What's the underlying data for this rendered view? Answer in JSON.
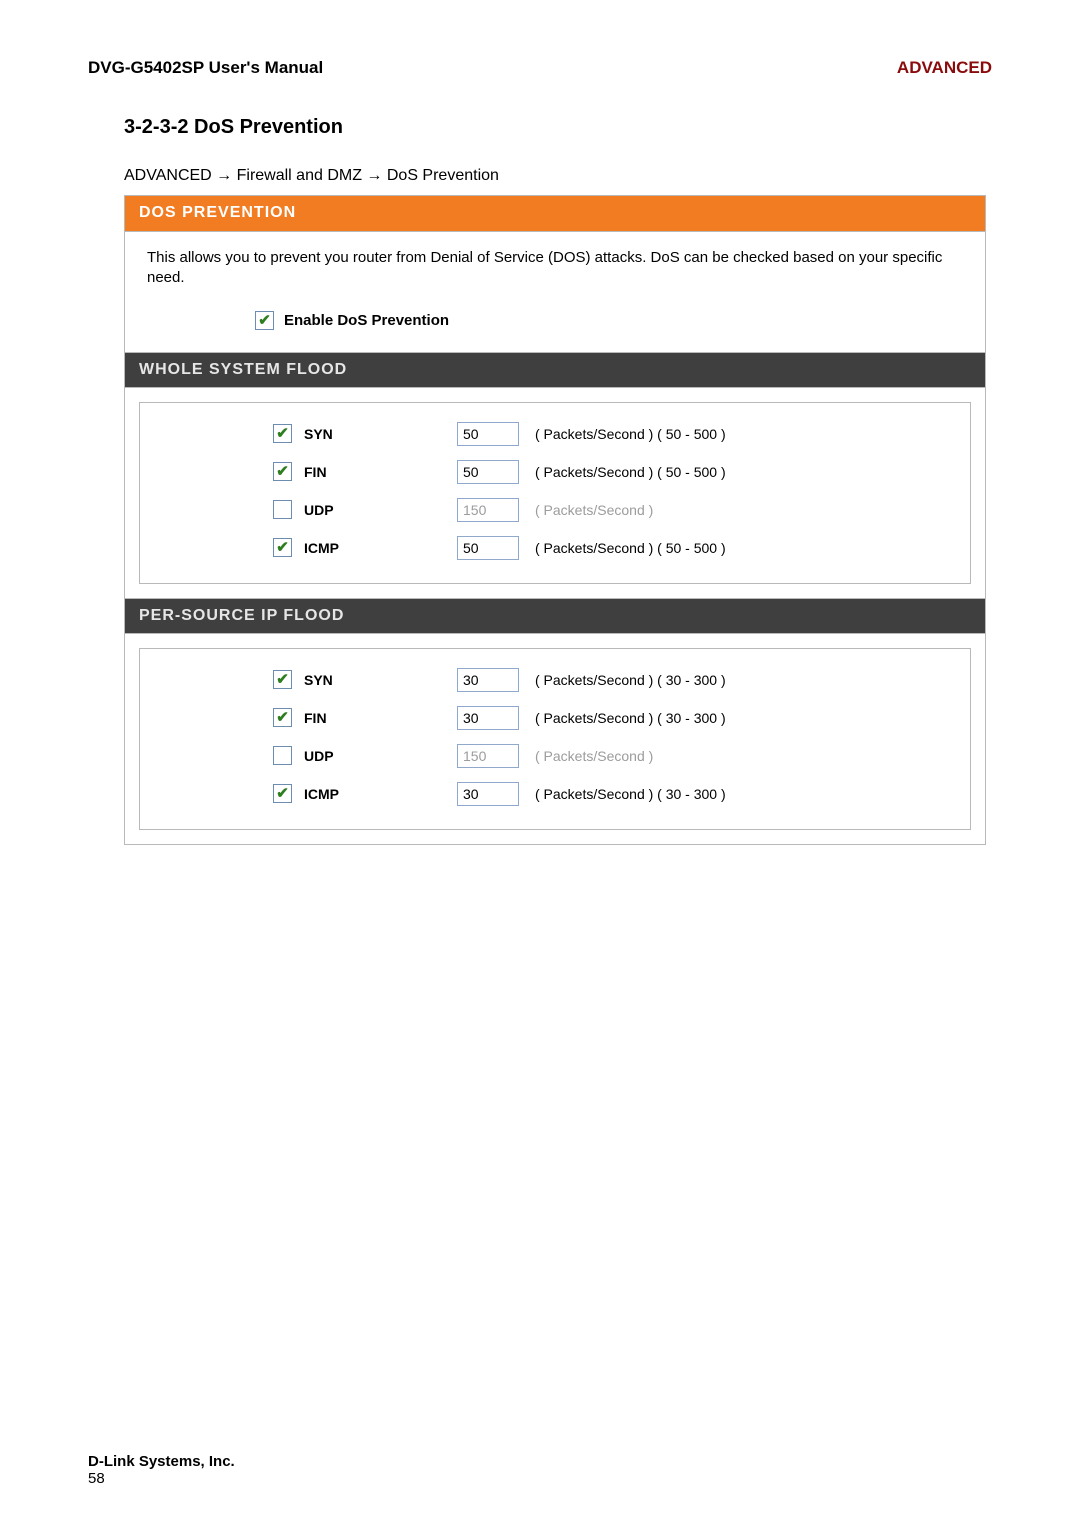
{
  "header": {
    "manual_title": "DVG-G5402SP User's Manual",
    "section_tag": "ADVANCED"
  },
  "section": {
    "heading": "3-2-3-2 DoS Prevention",
    "breadcrumb": "ADVANCED  →  Firewall and DMZ  →  DoS Prevention"
  },
  "panel": {
    "title": "DOS PREVENTION",
    "description": "This allows you to prevent you router from Denial of Service (DOS) attacks. DoS can be checked based on your specific need.",
    "enable": {
      "label": "Enable DoS Prevention",
      "checked": true
    },
    "whole_system": {
      "title": "WHOLE SYSTEM FLOOD",
      "rows": [
        {
          "key": "syn",
          "label": "SYN",
          "checked": true,
          "value": "50",
          "hint": "( Packets/Second ) ( 50 - 500 )",
          "disabled": false
        },
        {
          "key": "fin",
          "label": "FIN",
          "checked": true,
          "value": "50",
          "hint": "( Packets/Second ) ( 50 - 500 )",
          "disabled": false
        },
        {
          "key": "udp",
          "label": "UDP",
          "checked": false,
          "value": "150",
          "hint": "( Packets/Second )",
          "disabled": true
        },
        {
          "key": "icmp",
          "label": "ICMP",
          "checked": true,
          "value": "50",
          "hint": "( Packets/Second ) ( 50 - 500 )",
          "disabled": false
        }
      ]
    },
    "per_source": {
      "title": "PER-SOURCE IP FLOOD",
      "rows": [
        {
          "key": "syn",
          "label": "SYN",
          "checked": true,
          "value": "30",
          "hint": "( Packets/Second ) ( 30 - 300 )",
          "disabled": false
        },
        {
          "key": "fin",
          "label": "FIN",
          "checked": true,
          "value": "30",
          "hint": "( Packets/Second ) ( 30 - 300 )",
          "disabled": false
        },
        {
          "key": "udp",
          "label": "UDP",
          "checked": false,
          "value": "150",
          "hint": "( Packets/Second )",
          "disabled": true
        },
        {
          "key": "icmp",
          "label": "ICMP",
          "checked": true,
          "value": "30",
          "hint": "( Packets/Second ) ( 30 - 300 )",
          "disabled": false
        }
      ]
    }
  },
  "footer": {
    "company": "D-Link Systems, Inc.",
    "page": "58"
  }
}
